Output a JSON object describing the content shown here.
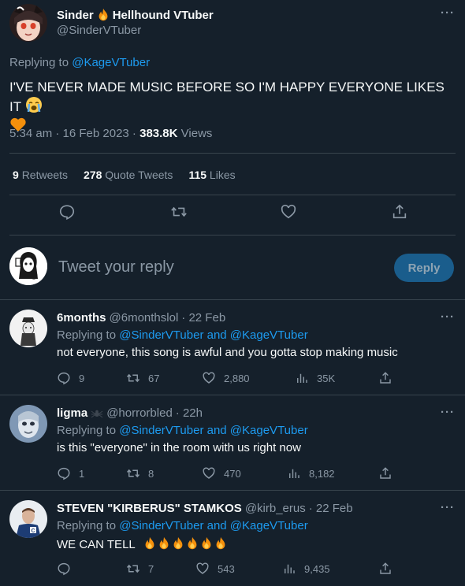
{
  "main_tweet": {
    "display_name": "Sinder",
    "name_suffix": "Hellhound VTuber",
    "handle": "@SinderVTuber",
    "replying_label": "Replying to",
    "replying_to": "@KageVTuber",
    "text": "I'VE NEVER MADE MUSIC BEFORE SO I'M HAPPY EVERYONE LIKES IT",
    "time": "5:34 am · 16 Feb 2023 ·",
    "views_count": "383.8K",
    "views_label": "Views",
    "retweets_count": "9",
    "retweets_label": "Retweets",
    "quotes_count": "278",
    "quotes_label": "Quote Tweets",
    "likes_count": "115",
    "likes_label": "Likes",
    "more": "···"
  },
  "compose": {
    "placeholder": "Tweet your reply",
    "button": "Reply"
  },
  "replies": [
    {
      "name": "6months",
      "handle": "@6monthslol",
      "date": "· 22 Feb",
      "replying_label": "Replying to",
      "replying_to": "@SinderVTuber and @KageVTuber",
      "text": "not everyone, this song is awful and you gotta stop making music",
      "replies": "9",
      "retweets": "67",
      "likes": "2,880",
      "views": "35K"
    },
    {
      "name": "ligma",
      "handle": "@horrorbled",
      "date": "· 22h",
      "replying_label": "Replying to",
      "replying_to": "@SinderVTuber and @KageVTuber",
      "text": "is this \"everyone\" in the room with us right now",
      "replies": "1",
      "retweets": "8",
      "likes": "470",
      "views": "8,182"
    },
    {
      "name": "STEVEN \"KIRBERUS\" STAMKOS",
      "handle": "@kirb_erus",
      "date": "· 22 Feb",
      "replying_label": "Replying to",
      "replying_to": "@SinderVTuber and @KageVTuber",
      "text": "WE CAN TELL",
      "replies": "",
      "retweets": "7",
      "likes": "543",
      "views": "9,435"
    }
  ],
  "colors": {
    "background": "#15202b",
    "accent": "#1d9bf0",
    "muted": "#8b98a5",
    "divider": "#38444d"
  }
}
